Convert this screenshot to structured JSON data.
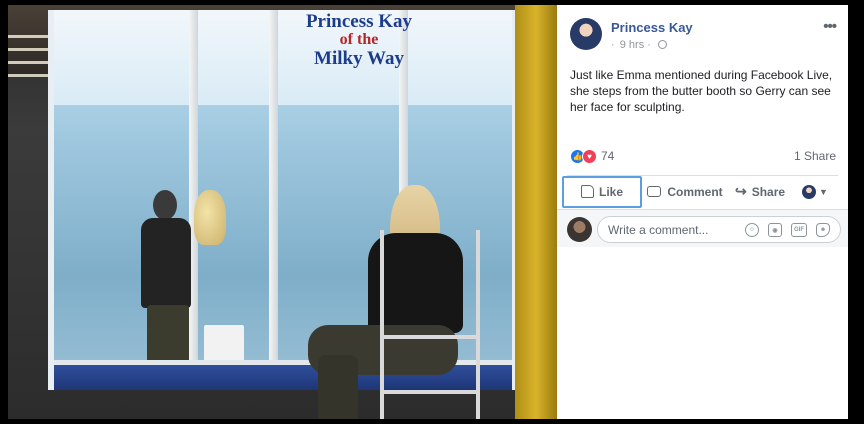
{
  "booth_sign": {
    "line1": "Princess Kay",
    "line2": "of the",
    "line3": "Milky Way"
  },
  "post": {
    "page_name": "Princess Kay",
    "time": "9 hrs",
    "separator": "·",
    "text": "Just like Emma mentioned during Facebook Live, she steps from the butter booth so Gerry can see her face for sculpting.",
    "reaction_count": "74",
    "share_count": "1 Share",
    "more_icon": "more-horizontal-icon",
    "privacy_icon": "globe-icon"
  },
  "actions": {
    "like_label": "Like",
    "comment_label": "Comment",
    "share_label": "Share"
  },
  "comment": {
    "placeholder": "Write a comment...",
    "tools": [
      "emoji-icon",
      "camera-icon",
      "gif-icon",
      "sticker-icon"
    ]
  },
  "colors": {
    "brand_link": "#385898",
    "like_blue": "#1877f2",
    "love_red": "#f33e58",
    "booth_sign_blue": "#1c3c8c",
    "booth_sign_red": "#b52626"
  }
}
